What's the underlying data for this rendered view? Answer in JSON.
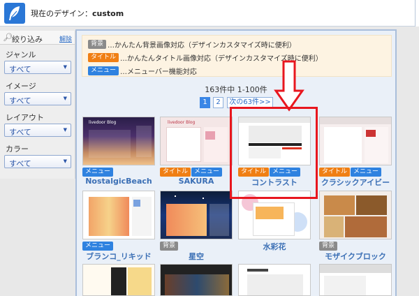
{
  "header": {
    "current_design_label": "現在のデザイン：",
    "current_design_value": "custom"
  },
  "sidebar": {
    "title": "絞り込み",
    "clear_label": "解除",
    "filters": [
      {
        "label": "ジャンル",
        "value": "すべて"
      },
      {
        "label": "イメージ",
        "value": "すべて"
      },
      {
        "label": "レイアウト",
        "value": "すべて"
      },
      {
        "label": "カラー",
        "value": "すべて"
      }
    ]
  },
  "legend": [
    {
      "badge": "背景",
      "text": "…かんたん背景画像対応（デザインカスタマイズ時に便利）"
    },
    {
      "badge": "タイトル",
      "text": "…かんたんタイトル画像対応（デザインカスタマイズ時に便利）"
    },
    {
      "badge": "メニュー",
      "text": "…メニューバー機能対応"
    }
  ],
  "results": {
    "count_text": "163件中 1-100件",
    "pages": [
      "1",
      "2"
    ],
    "next_label": "次の63件>>"
  },
  "designs": [
    {
      "name": "NostalgicBeach",
      "badges": [
        "メニュー"
      ]
    },
    {
      "name": "SAKURA",
      "badges": [
        "タイトル",
        "メニュー"
      ]
    },
    {
      "name": "コントラスト",
      "badges": [
        "タイトル",
        "メニュー"
      ]
    },
    {
      "name": "クラシックアイビー",
      "badges": [
        "タイトル",
        "メニュー"
      ]
    },
    {
      "name": "ブランコ_リキッド",
      "badges": [
        "メニュー"
      ]
    },
    {
      "name": "星空",
      "badges": [
        "背景"
      ]
    },
    {
      "name": "水彩花",
      "badges": []
    },
    {
      "name": "モザイクブロック",
      "badges": [
        "背景"
      ]
    }
  ],
  "colors": {
    "badge_bg": "#8a8a8a",
    "badge_title": "#f07f14",
    "badge_menu": "#2f82e0",
    "highlight": "#e8161e",
    "link": "#3b6fb5"
  },
  "icons": {
    "logo": "feather-icon",
    "search": "magnifier-icon",
    "dropdown": "chevron-down-icon",
    "annotation": "arrow-down-icon"
  }
}
